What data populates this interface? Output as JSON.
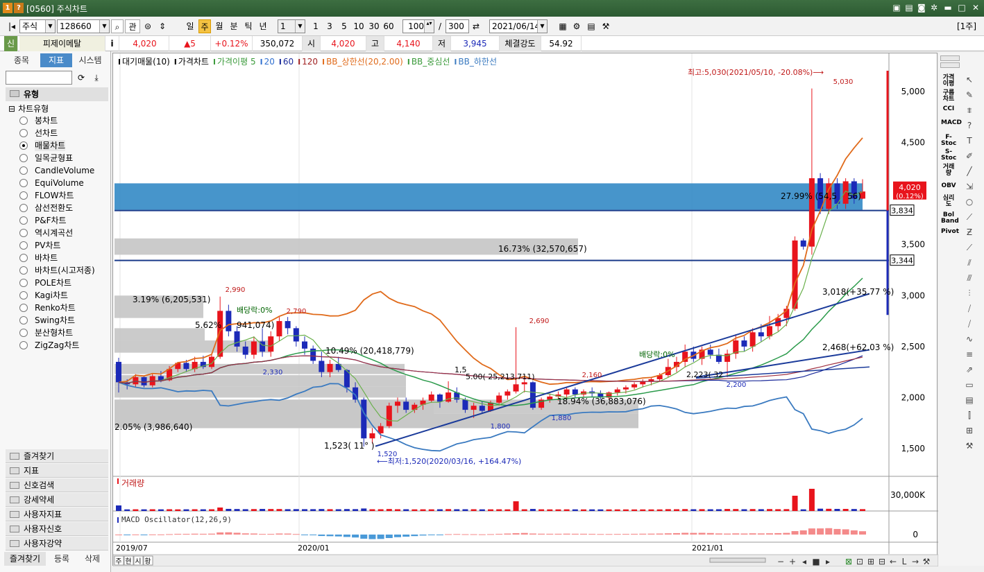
{
  "window": {
    "title": "[0560] 주식차트",
    "icon1": "1",
    "icon2": "?"
  },
  "toolbar": {
    "market": "주식",
    "code": "128660",
    "gwan": "관",
    "periods": [
      "일",
      "주",
      "월",
      "분",
      "틱",
      "년"
    ],
    "selected_period": "주",
    "interval": "1",
    "quick": [
      "1",
      "3",
      "5",
      "10",
      "30",
      "60"
    ],
    "count": "100",
    "slash": "/",
    "total": "300",
    "date": "2021/06/14",
    "badge": "[1주]"
  },
  "quote": {
    "sin": "신",
    "name": "피제이메탈",
    "info": "i",
    "price": "4,020",
    "change": "▲5",
    "pct": "+0.12%",
    "volume": "350,072",
    "open_label": "시",
    "open": "4,020",
    "high_label": "고",
    "high": "4,140",
    "low_label": "저",
    "low": "3,945",
    "strength_label": "체결강도",
    "strength": "54.92"
  },
  "left": {
    "tabs": [
      "종목",
      "지표",
      "시스템"
    ],
    "selected_tab": "지표",
    "section": "유형",
    "tree_root": "차트유형",
    "chart_types": [
      "봉차트",
      "선차트",
      "매물차트",
      "일목균형표",
      "CandleVolume",
      "EquiVolume",
      "FLOW차트",
      "삼선전환도",
      "P&F차트",
      "역시계곡선",
      "PV차트",
      "바차트",
      "바차트(시고저종)",
      "POLE차트",
      "Kagi차트",
      "Renko차트",
      "Swing차트",
      "분산형차트",
      "ZigZag차트"
    ],
    "selected_chart_type": "매물차트",
    "folders": [
      "즐겨찾기",
      "지표",
      "신호검색",
      "강세약세",
      "사용자지표",
      "사용자신호",
      "사용자강약"
    ],
    "bottom_tabs": [
      "즐겨찾기",
      "등록",
      "삭제"
    ]
  },
  "chart": {
    "legend": [
      "대기매물(10)",
      "가격차트",
      "가격이평 5",
      "20",
      "60",
      "120",
      "BB_상한선(20,2.00)",
      "BB_중심선",
      "BB_하한선"
    ],
    "legend_colors": [
      "#000000",
      "#000000",
      "#3a9a3a",
      "#2f6fd0",
      "#1a2a9a",
      "#a02020",
      "#e06a1a",
      "#3a9a3a",
      "#3a7ac0"
    ],
    "price_axis": [
      "5,000",
      "4,500",
      "4,000",
      "3,500",
      "3,000",
      "2,500",
      "2,000",
      "1,500"
    ],
    "x_axis": [
      "2019/07",
      "2020/01",
      "2021/01"
    ],
    "annotations": {
      "max": "최고:5,030(2021/05/10, -20.08%)⟶",
      "max_val": "5,030",
      "min": "⟵최저:1,520(2020/03/16, +164.47%)",
      "min_val": "1,520",
      "p2990": "2,990",
      "p2790": "2,790",
      "p2690": "2,690",
      "p2160": "2,160",
      "p2330": "2,330",
      "p1800": "1,800",
      "p1880": "1,880",
      "p2200": "2,200",
      "div1": "배당락:0%",
      "div2": "배당락:0%",
      "tl1": "1,523( 11° )",
      "tl2": "3,018(+35.77 %)",
      "tl3": "2,468(+62.03 %)",
      "tl4": "2,223( 32",
      "tl5": "1,5",
      "tl6": "5.00( 25,213,711)",
      "vp1": "27.99% (54,5",
      "vp1b": "56)",
      "vp2": "16.73% (32,570,657)",
      "vp3": "3.19% (6,205,531)",
      "vp4": "5.62%",
      "vp4b": "941,074)",
      "vp5": "10.49% (20,418,779)",
      "vp6": "18.94% (36,883,076)",
      "vp7": "2.05% (3,986,640)",
      "current": "4,020",
      "current_pct": "(0.12%)",
      "lvl1": "3,834",
      "lvl2": "3,344"
    },
    "volume_title": "거래량",
    "volume_axis": "30,000K",
    "macd_title": "MACD Oscillator(12,26,9)",
    "macd_axis": "0",
    "bottom_tabs": [
      "주",
      "현",
      "시",
      "황"
    ]
  },
  "right": {
    "items": [
      "가격이평",
      "구름차트",
      "CCI",
      "MACD",
      "F-Stoc",
      "S-Stoc",
      "거래량",
      "OBV",
      "심리도",
      "Bol Band",
      "Pivot"
    ]
  },
  "colors": {
    "up": "#e8141c",
    "down": "#1c2ab8",
    "title_bg": "#2f5e35",
    "accent": "#4a8bc9",
    "band": "#3d8fc8"
  }
}
